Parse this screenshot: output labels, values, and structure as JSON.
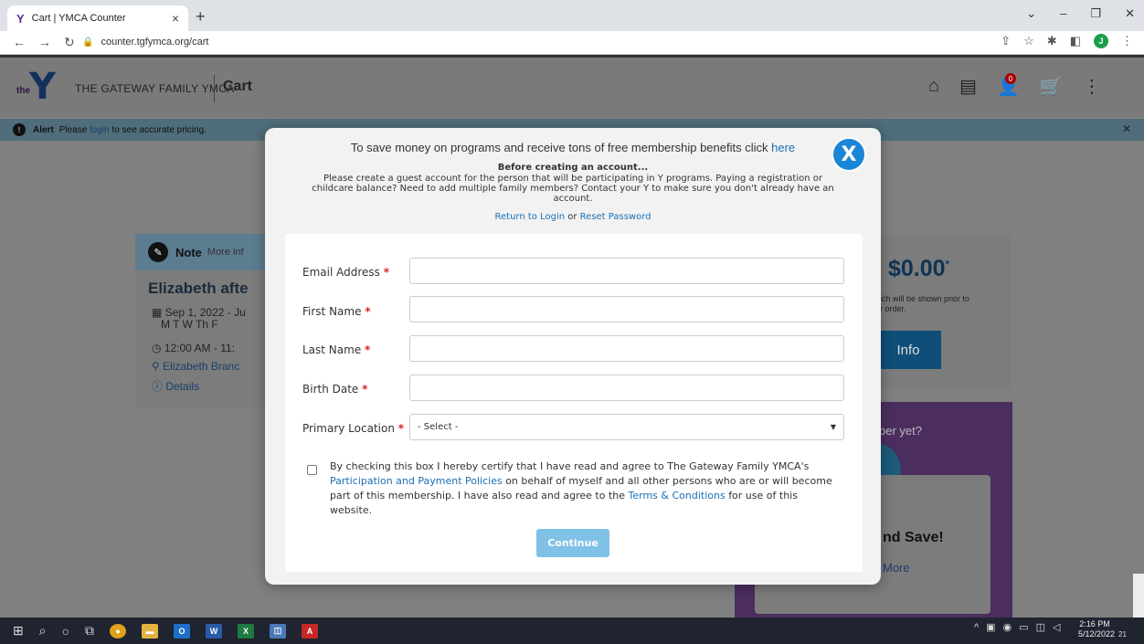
{
  "browser": {
    "tab_title": "Cart | YMCA Counter",
    "url": "counter.tgfymca.org/cart",
    "profile_initial": "J"
  },
  "site": {
    "logo_text": "the",
    "name": "THE GATEWAY FAMILY YMCA",
    "page_title": "Cart",
    "cart_count": "0"
  },
  "alert": {
    "label": "Alert",
    "text_before": "Please",
    "link": "login",
    "text_after": "to see accurate pricing."
  },
  "background": {
    "note_label": "Note",
    "note_more": "More inf",
    "program_title": "Elizabeth afte",
    "program_date": "Sep 1, 2022 - Ju",
    "program_days": "M T W Th F",
    "program_time": "12:00 AM - 11:",
    "program_location": "Elizabeth Branc",
    "program_details": "Details",
    "total": "$0.00",
    "total_note_line1": "hich will be shown prior to",
    "total_note_line2": "ur order.",
    "info_button": "Info",
    "promo_text": "ber yet?",
    "promo_save": "nd Save!",
    "promo_more": "More"
  },
  "modal": {
    "promo_text": "To save money on programs and receive tons of free membership benefits click",
    "promo_link": "here",
    "close_label": "X",
    "before_title": "Before creating an account...",
    "guest_note": "Please create a guest account for the person that will be participating in Y programs. Paying a registration or childcare balance?  Need to add multiple family members? Contact your Y to make sure you don't already have an account.",
    "return_login": "Return to Login",
    "or_text": "or",
    "reset_password": "Reset Password",
    "fields": {
      "email": "Email Address",
      "first_name": "First Name",
      "last_name": "Last Name",
      "birth_date": "Birth Date",
      "primary_location": "Primary Location",
      "required_mark": "*"
    },
    "location_selected": "- Select -",
    "agree_text_1": "By checking this box I hereby certify that I have read and agree to The Gateway Family YMCA's",
    "agree_link_1": "Participation and Payment Policies",
    "agree_text_2": "on behalf of myself and all other persons who are or will become part of this membership. I have also read and agree to the",
    "agree_link_2": "Terms & Conditions",
    "agree_text_3": "for use of this website.",
    "continue_button": "Continue"
  },
  "taskbar": {
    "time": "2:16 PM",
    "date": "5/12/2022",
    "notification_count": "21"
  }
}
